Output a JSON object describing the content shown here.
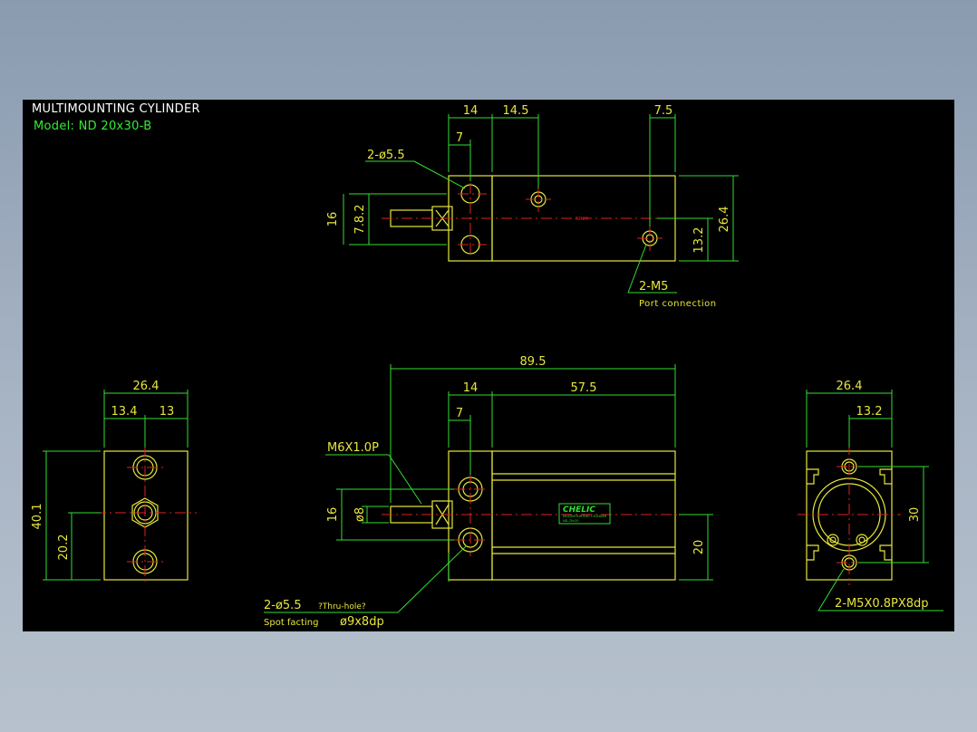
{
  "header": {
    "title": "MULTIMOUNTING CYLINDER",
    "model": "Model: ND 20x30-B"
  },
  "colors": {
    "background": "#000000",
    "outline": "#e6e63c",
    "dimension": "#33dd33",
    "centerline": "#e02020",
    "frame": "#9aa9bb"
  },
  "views": {
    "top": {
      "dims": {
        "d14": "14",
        "d14_5": "14.5",
        "d7_5": "7.5",
        "d7": "7",
        "d16": "16",
        "d7_8_2": "7.8.2",
        "d26_4": "26.4",
        "d13_2": "13.2"
      },
      "callouts": {
        "holes": "2-ø5.5",
        "ports": "2-M5",
        "port_note": "Port connection"
      },
      "body_mark": "ND20"
    },
    "side": {
      "dims": {
        "d26_4": "26.4",
        "d13_4": "13.4",
        "d13": "13",
        "d40_1": "40.1",
        "d20_2": "20.2"
      }
    },
    "front": {
      "dims": {
        "d89_5": "89.5",
        "d14": "14",
        "d57_5": "57.5",
        "d7": "7",
        "d16": "16",
        "d8": "ø8",
        "d20": "20"
      },
      "callouts": {
        "thread": "M6X1.0P",
        "holes": "2-ø5.5",
        "holes_note": "?Thru-hole?",
        "spot": "Spot facting",
        "spot_dim": "ø9x8dp"
      },
      "label_plate": {
        "brand": "CHELIC",
        "line1": "MULTIMOUNTING CYLINDER",
        "line2": "ND-20x30"
      }
    },
    "end": {
      "dims": {
        "d26_4": "26.4",
        "d13_2": "13.2",
        "d30": "30"
      },
      "callouts": {
        "threads": "2-M5X0.8PX8dp"
      }
    }
  }
}
